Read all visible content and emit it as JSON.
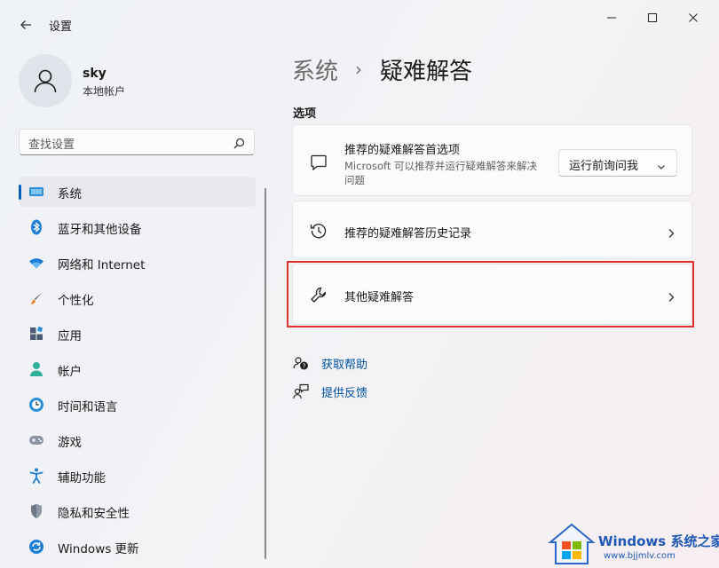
{
  "window": {
    "title": "设置"
  },
  "user": {
    "name": "sky",
    "account_type": "本地帐户"
  },
  "search": {
    "placeholder": "查找设置"
  },
  "sidebar": {
    "items": [
      {
        "label": "系统",
        "icon": "monitor-icon",
        "active": true
      },
      {
        "label": "蓝牙和其他设备",
        "icon": "bluetooth-icon"
      },
      {
        "label": "网络和 Internet",
        "icon": "wifi-icon"
      },
      {
        "label": "个性化",
        "icon": "brush-icon"
      },
      {
        "label": "应用",
        "icon": "apps-icon"
      },
      {
        "label": "帐户",
        "icon": "person-icon"
      },
      {
        "label": "时间和语言",
        "icon": "clock-globe-icon"
      },
      {
        "label": "游戏",
        "icon": "gamepad-icon"
      },
      {
        "label": "辅助功能",
        "icon": "accessibility-icon"
      },
      {
        "label": "隐私和安全性",
        "icon": "shield-icon"
      },
      {
        "label": "Windows 更新",
        "icon": "update-icon"
      }
    ]
  },
  "breadcrumb": {
    "parent": "系统",
    "separator": "›",
    "current": "疑难解答"
  },
  "section": {
    "title": "选项"
  },
  "cards": {
    "preferences": {
      "title": "推荐的疑难解答首选项",
      "description": "Microsoft 可以推荐并运行疑难解答来解决问题",
      "dropdown_value": "运行前询问我"
    },
    "history": {
      "title": "推荐的疑难解答历史记录"
    },
    "other": {
      "title": "其他疑难解答"
    }
  },
  "links": {
    "help": "获取帮助",
    "feedback": "提供反馈"
  },
  "watermark": {
    "brand": "Windows",
    "brand_suffix": "系统之家",
    "url": "www.bjjmlv.com"
  },
  "colors": {
    "accent": "#005fb8",
    "highlight": "#e0302e",
    "link": "#0052a3"
  }
}
